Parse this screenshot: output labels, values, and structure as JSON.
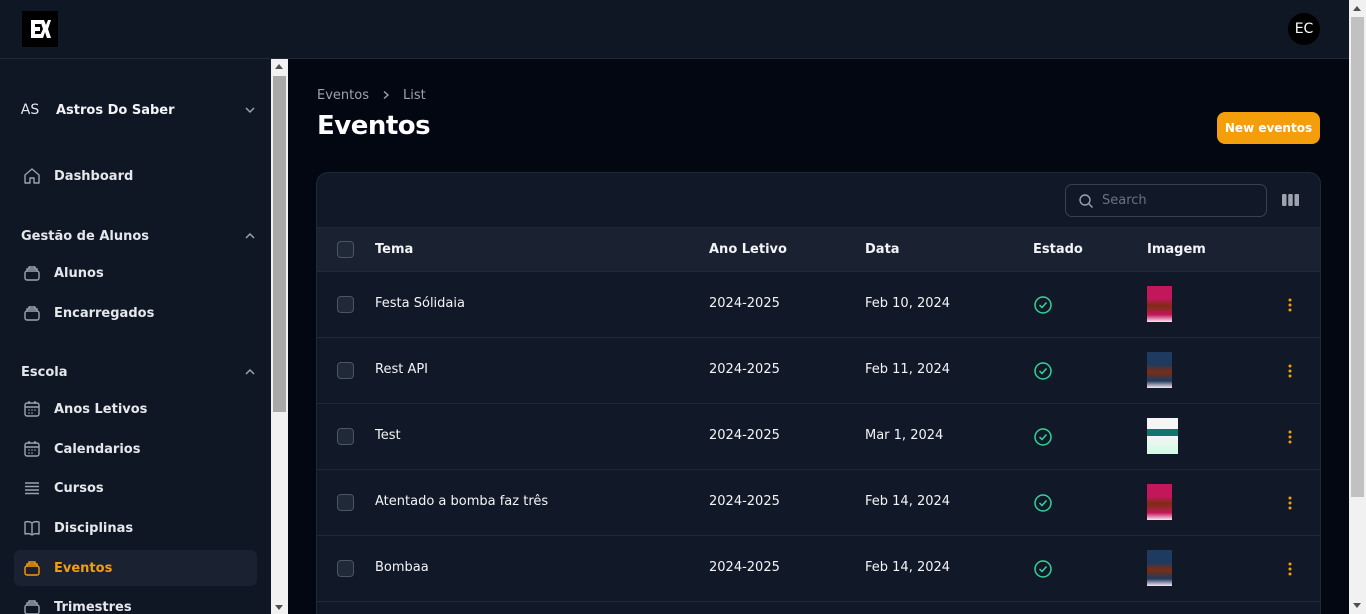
{
  "app": {
    "logo_text": "EX",
    "user_initials": "EC"
  },
  "tenant": {
    "abbr": "AS",
    "name": "Astros Do Saber"
  },
  "sidebar": {
    "dashboard": "Dashboard",
    "groups": [
      {
        "label": "Gestão de Alunos",
        "items": [
          "Alunos",
          "Encarregados"
        ]
      },
      {
        "label": "Escola",
        "items": [
          "Anos Letivos",
          "Calendarios",
          "Cursos",
          "Disciplinas",
          "Eventos",
          "Trimestres"
        ]
      }
    ],
    "active": "Eventos"
  },
  "breadcrumb": [
    "Eventos",
    "List"
  ],
  "page_title": "Eventos",
  "new_button": "New eventos",
  "search": {
    "placeholder": "Search",
    "value": ""
  },
  "table": {
    "headers": [
      "Tema",
      "Ano Letivo",
      "Data",
      "Estado",
      "Imagem"
    ],
    "rows": [
      {
        "tema": "Festa Sólidaia",
        "ano": "2024-2025",
        "data": "Feb 10, 2024",
        "estado": "active",
        "image_color": "#c2185b"
      },
      {
        "tema": "Rest API",
        "ano": "2024-2025",
        "data": "Feb 11, 2024",
        "estado": "active",
        "image_color": "#1e3a5f"
      },
      {
        "tema": "Test",
        "ano": "2024-2025",
        "data": "Mar 1, 2024",
        "estado": "active",
        "image_color": "#e8f5e9"
      },
      {
        "tema": "Atentado a bomba faz três",
        "ano": "2024-2025",
        "data": "Feb 14, 2024",
        "estado": "active",
        "image_color": "#c2185b"
      },
      {
        "tema": "Bombaa",
        "ano": "2024-2025",
        "data": "Feb 14, 2024",
        "estado": "active",
        "image_color": "#1e3a5f"
      }
    ]
  },
  "colors": {
    "accent": "#f59e0b",
    "success": "#34d399",
    "bg": "#030712",
    "panel": "#111827"
  }
}
